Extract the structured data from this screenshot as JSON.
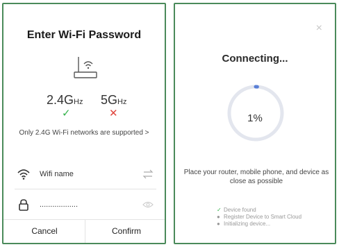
{
  "left_panel": {
    "title": "Enter Wi-Fi Password",
    "band_24": "2.4G",
    "band_24_unit": "Hz",
    "band_5": "5G",
    "band_5_unit": "Hz",
    "band_24_status": "✓",
    "band_5_status": "✕",
    "note": "Only 2.4G Wi-Fi networks are supported >",
    "wifi_name_value": "Wifi name",
    "password_value": "..................",
    "cancel_label": "Cancel",
    "confirm_label": "Confirm",
    "icons": {
      "router": "router-icon",
      "wifi": "wifi-icon",
      "lock": "lock-icon",
      "switch": "swap-icon",
      "eye": "eye-icon"
    },
    "colors": {
      "ok": "#33b24a",
      "error": "#e0453d",
      "border": "#4a8a5a"
    }
  },
  "right_panel": {
    "close": "×",
    "title": "Connecting...",
    "progress_label": "1%",
    "progress": 0.01,
    "hint": "Place your router, mobile phone, and device as close as possible",
    "steps": [
      {
        "mark": "✓",
        "label": "Device found"
      },
      {
        "mark": "●",
        "label": "Register Device to Smart Cloud"
      },
      {
        "mark": "●",
        "label": "Initializing device..."
      }
    ],
    "colors": {
      "ring": "#e3e6ee",
      "ring_progress": "#5a7fd6"
    }
  }
}
